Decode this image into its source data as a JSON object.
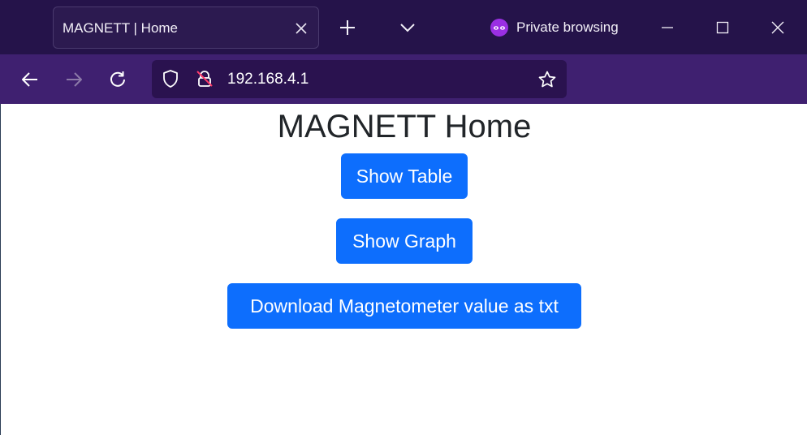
{
  "browser": {
    "tab": {
      "title": "MAGNETT | Home"
    },
    "private_label": "Private browsing",
    "url": "192.168.4.1",
    "icons": {
      "tab_close": "close-icon",
      "new_tab": "plus-icon",
      "tab_list": "chevron-down-icon",
      "private": "private-mask-icon",
      "minimize": "minimize-icon",
      "maximize": "maximize-icon",
      "close": "close-icon",
      "back": "arrow-left-icon",
      "forward": "arrow-right-icon",
      "reload": "reload-icon",
      "tracking_protection": "shield-icon",
      "insecure": "lock-insecure-icon",
      "bookmark": "star-icon"
    },
    "colors": {
      "titlebar": "#25134a",
      "toolbar": "#3f2070",
      "urlbar": "#2a124f",
      "private_accent": "#9a2fe3"
    }
  },
  "page": {
    "title": "MAGNETT Home",
    "buttons": {
      "show_table": "Show Table",
      "show_graph": "Show Graph",
      "download": "Download Magnetometer value as txt"
    },
    "colors": {
      "button": "#0d6efd",
      "button_text": "#ffffff",
      "heading": "#212529"
    }
  }
}
